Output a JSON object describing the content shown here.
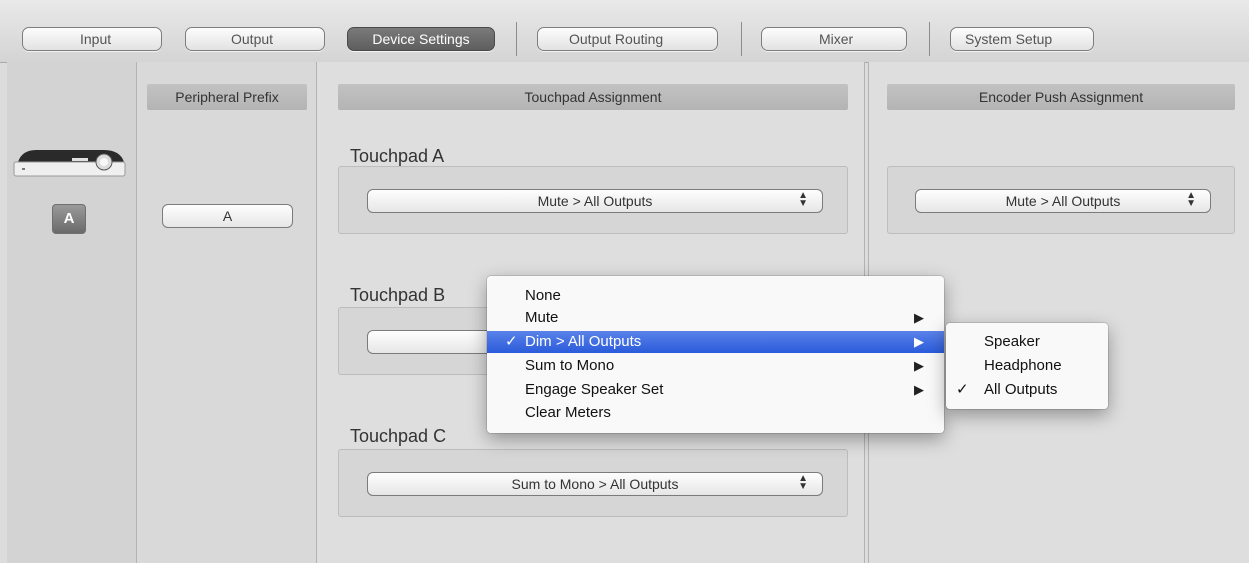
{
  "tabs": {
    "input": "Input",
    "output": "Output",
    "device_settings": "Device Settings",
    "output_routing": "Output Routing",
    "mixer": "Mixer",
    "system_setup": "System Setup"
  },
  "device": {
    "badge": "A",
    "icon": "interface-device-icon"
  },
  "prefix": {
    "header": "Peripheral Prefix",
    "value": "A"
  },
  "touchpad": {
    "header": "Touchpad Assignment",
    "a_title": "Touchpad A",
    "a_value": "Mute > All Outputs",
    "b_title": "Touchpad B",
    "b_value": "",
    "c_title": "Touchpad C",
    "c_value": "Sum to Mono > All Outputs"
  },
  "encoder": {
    "header": "Encoder Push Assignment",
    "value": "Mute > All Outputs"
  },
  "menu": {
    "items": [
      {
        "label": "None",
        "checked": false,
        "submenu": false
      },
      {
        "label": "Mute",
        "checked": false,
        "submenu": true
      },
      {
        "label": "Dim > All Outputs",
        "checked": true,
        "submenu": true,
        "highlighted": true
      },
      {
        "label": "Sum to Mono",
        "checked": false,
        "submenu": true
      },
      {
        "label": "Engage Speaker Set",
        "checked": false,
        "submenu": true
      },
      {
        "label": "Clear Meters",
        "checked": false,
        "submenu": false
      }
    ],
    "check_glyph": "✓",
    "submenu_glyph": "▶"
  },
  "submenu": {
    "items": [
      {
        "label": "Speaker",
        "checked": false
      },
      {
        "label": "Headphone",
        "checked": false
      },
      {
        "label": "All Outputs",
        "checked": true
      }
    ]
  },
  "colors": {
    "highlight": "#2b5bdb",
    "active_tab": "#6a6a6a"
  }
}
